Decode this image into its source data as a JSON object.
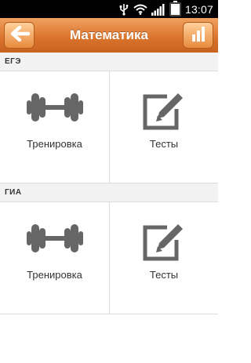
{
  "status_bar": {
    "time": "13:07"
  },
  "app_bar": {
    "title": "Математика",
    "back_icon": "arrow-left-icon",
    "stats_icon": "bar-chart-icon"
  },
  "sections": [
    {
      "header": "ЕГЭ",
      "tiles": [
        {
          "label": "Тренировка",
          "icon": "dumbbell-icon"
        },
        {
          "label": "Тесты",
          "icon": "edit-icon"
        }
      ]
    },
    {
      "header": "ГИА",
      "tiles": [
        {
          "label": "Тренировка",
          "icon": "dumbbell-icon"
        },
        {
          "label": "Тесты",
          "icon": "edit-icon"
        }
      ]
    }
  ],
  "colors": {
    "app_bar": "#d9722b",
    "status_bar": "#000000",
    "icon": "#666666"
  }
}
